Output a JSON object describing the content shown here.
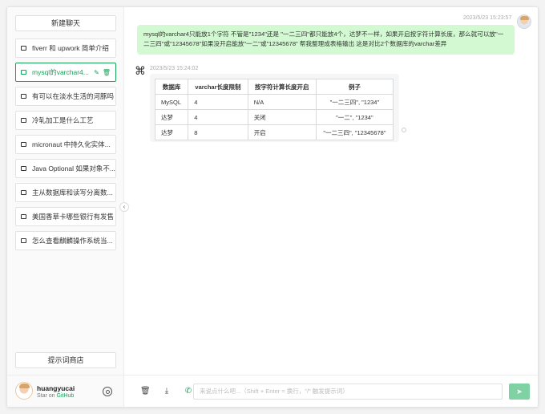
{
  "sidebar": {
    "new_chat_label": "新建聊天",
    "items": [
      {
        "label": "fiverr 和 upwork 简单介绍",
        "active": false
      },
      {
        "label": "mysql的varchar4...",
        "active": true
      },
      {
        "label": "有可以在淡水生活的河豚吗",
        "active": false
      },
      {
        "label": "冷轧加工是什么工艺",
        "active": false
      },
      {
        "label": "micronaut 中持久化实体...",
        "active": false
      },
      {
        "label": "Java Optional 如果对象不...",
        "active": false
      },
      {
        "label": "主从数据库和读写分离数...",
        "active": false
      },
      {
        "label": "美国香草卡哪些银行有发售",
        "active": false
      },
      {
        "label": "怎么查看麒麟操作系统当...",
        "active": false
      }
    ],
    "prompt_store_label": "提示词商店"
  },
  "user": {
    "name": "huangyucai",
    "star_text": "Star on ",
    "github_text": "GitHub"
  },
  "chat": {
    "user_time": "2023/5/23 15:23:57",
    "user_message": "mysql的varchar4只能放1个字符 不管是\"1234\"还是 \"一二三四\"都只能放4个，达梦不一样，如果开启按字符计算长度，那么就可以放\"一二三四\"或\"12345678\"如果没开启能放\"一二\"或\"12345678\" 帮我整理成表格输出 这是对比2个数据库的varchar差异",
    "bot_time": "2023/5/23 15:24:02",
    "table": {
      "headers": [
        "数据库",
        "varchar长度限制",
        "按字符计算长度开启",
        "例子"
      ],
      "rows": [
        [
          "MySQL",
          "4",
          "N/A",
          "\"一二三四\", \"1234\""
        ],
        [
          "达梦",
          "4",
          "关闭",
          "\"一二\", \"1234\""
        ],
        [
          "达梦",
          "8",
          "开启",
          "\"一二三四\", \"12345678\""
        ]
      ]
    }
  },
  "input": {
    "placeholder": "来说点什么吧...（Shift + Enter = 换行，\"/\" 触发提示词）"
  },
  "icons": {
    "chat": "chat-bubble-icon",
    "edit": "edit-icon",
    "delete": "trash-icon",
    "settings": "gear-icon",
    "collapse": "chevron-left-icon",
    "bot": "openai-logo-icon",
    "download": "download-icon",
    "whatsapp": "whatsapp-icon",
    "send": "send-icon"
  },
  "colors": {
    "accent": "#18a058",
    "user_bubble": "#d2f9d1",
    "send_button": "#7fd2a3"
  }
}
